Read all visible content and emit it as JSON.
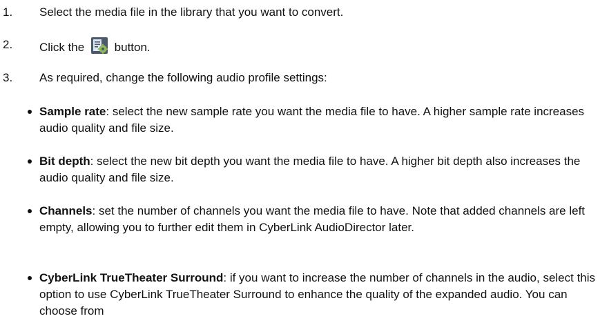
{
  "steps": [
    {
      "number": "1.",
      "text": "Select the media file in the library that you want to convert."
    },
    {
      "number": "2.",
      "text_before": "Click the",
      "icon": "media-settings-icon",
      "text_after": "button."
    },
    {
      "number": "3.",
      "text": "As required, change the following audio profile settings:"
    }
  ],
  "bullets": [
    {
      "term": "Sample rate",
      "description": ": select the new sample rate you want the media file to have. A higher sample rate increases audio quality and file size."
    },
    {
      "term": "Bit depth",
      "description": ": select the new bit depth you want the media file to have. A higher bit depth also increases the audio quality and file size."
    },
    {
      "term": "Channels",
      "description": ": set the number of channels you want the media file to have. Note that added channels are left empty, allowing you to further edit them in CyberLink AudioDirector later."
    },
    {
      "term": "CyberLink TrueTheater Surround",
      "description": ": if you want to increase the number of channels in the audio, select this option to use CyberLink TrueTheater Surround to enhance the quality of the expanded audio. You can choose from"
    }
  ],
  "colors": {
    "icon_bg": "#4a5a6a",
    "icon_accent": "#8fb85a"
  }
}
